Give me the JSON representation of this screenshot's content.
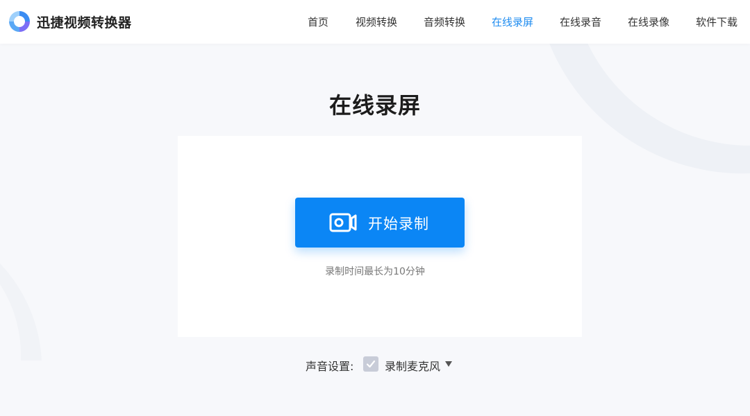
{
  "brand": {
    "name": "迅捷视频转换器",
    "logo_icon": "swirl-logo-icon"
  },
  "nav": {
    "items": [
      {
        "label": "首页",
        "active": false
      },
      {
        "label": "视频转换",
        "active": false
      },
      {
        "label": "音频转换",
        "active": false
      },
      {
        "label": "在线录屏",
        "active": true
      },
      {
        "label": "在线录音",
        "active": false
      },
      {
        "label": "在线录像",
        "active": false
      },
      {
        "label": "软件下载",
        "active": false
      }
    ]
  },
  "main": {
    "title": "在线录屏",
    "record_button": {
      "label": "开始录制",
      "icon": "camera-icon"
    },
    "hint": "录制时间最长为10分钟",
    "sound": {
      "label": "声音设置:",
      "checked": true,
      "option": "录制麦克风"
    }
  },
  "colors": {
    "accent": "#1f8cf0",
    "button": "#0b86f5",
    "background": "#f7f8fb",
    "card": "#ffffff",
    "checkbox": "#c8ccd8"
  }
}
